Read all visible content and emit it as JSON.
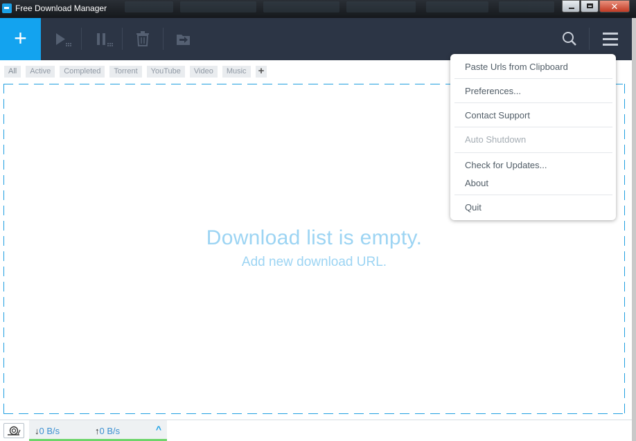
{
  "window": {
    "title": "Free Download Manager",
    "close_glyph": "✕"
  },
  "toolbar": {
    "add_glyph": "+",
    "icons": [
      "play-icon",
      "pause-icon",
      "trash-icon",
      "move-folder-icon",
      "search-icon",
      "hamburger-icon"
    ]
  },
  "tabs": [
    {
      "label": "All",
      "selected": true
    },
    {
      "label": "Active"
    },
    {
      "label": "Completed"
    },
    {
      "label": "Torrent"
    },
    {
      "label": "YouTube"
    },
    {
      "label": "Video"
    },
    {
      "label": "Music"
    }
  ],
  "tabs_add_glyph": "+",
  "empty_state": {
    "title": "Download list is empty.",
    "subtitle": "Add new download URL."
  },
  "menu": {
    "items": [
      {
        "label": "Paste Urls from Clipboard",
        "enabled": true
      },
      {
        "label": "Preferences...",
        "enabled": true
      },
      {
        "label": "Contact Support",
        "enabled": true
      },
      {
        "label": "Auto Shutdown",
        "enabled": false
      },
      {
        "label": "Check for Updates...",
        "enabled": true
      },
      {
        "label": "About",
        "enabled": true
      },
      {
        "label": "Quit",
        "enabled": true
      }
    ]
  },
  "status": {
    "download_speed": "0 B/s",
    "upload_speed": "0 B/s",
    "down_arrow": "↓",
    "up_arrow": "↑",
    "expand_glyph": "^"
  },
  "colors": {
    "accent": "#13a3ef",
    "toolbar_bg": "#2c3545",
    "empty_text": "#9cd4f3",
    "speed_bar": "#6dd46a"
  }
}
